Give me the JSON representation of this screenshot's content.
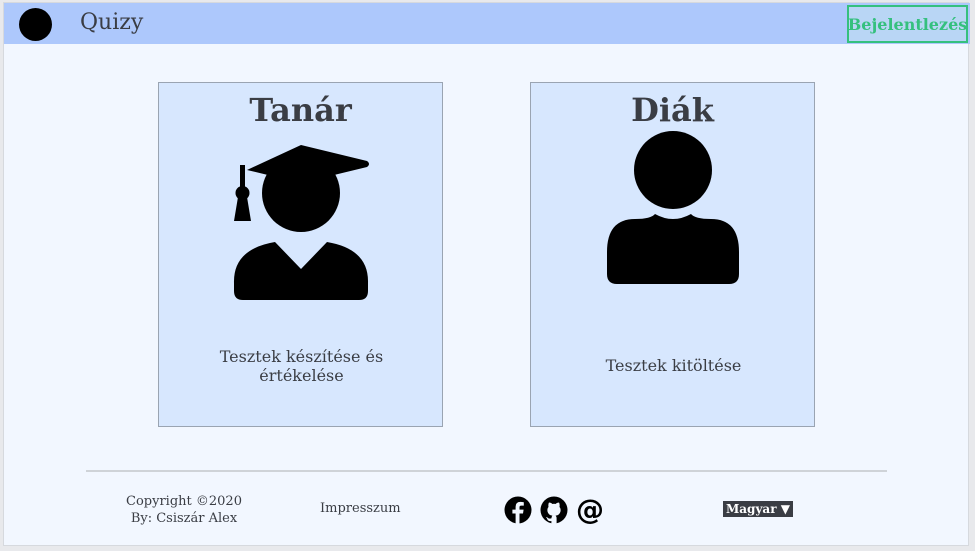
{
  "navbar": {
    "brand": "Quizy",
    "login_label": "Bejelentlezés"
  },
  "cards": [
    {
      "title": "Tanár",
      "description": "Tesztek készítése és értékelése",
      "icon": "graduate-icon"
    },
    {
      "title": "Diák",
      "description": "Tesztek kitöltése",
      "icon": "user-icon"
    }
  ],
  "footer": {
    "copyright_line1": "Copyright ©2020",
    "copyright_line2": "By: Csiszár Alex",
    "impressum": "Impresszum",
    "socials": [
      "facebook-icon",
      "github-icon",
      "email-icon"
    ],
    "language": "Magyar ▼"
  },
  "colors": {
    "navbar": "#adc8fc",
    "accent_green": "#35c07e",
    "card_bg": "#d7e7fe",
    "page_bg": "#f2f7ff"
  }
}
